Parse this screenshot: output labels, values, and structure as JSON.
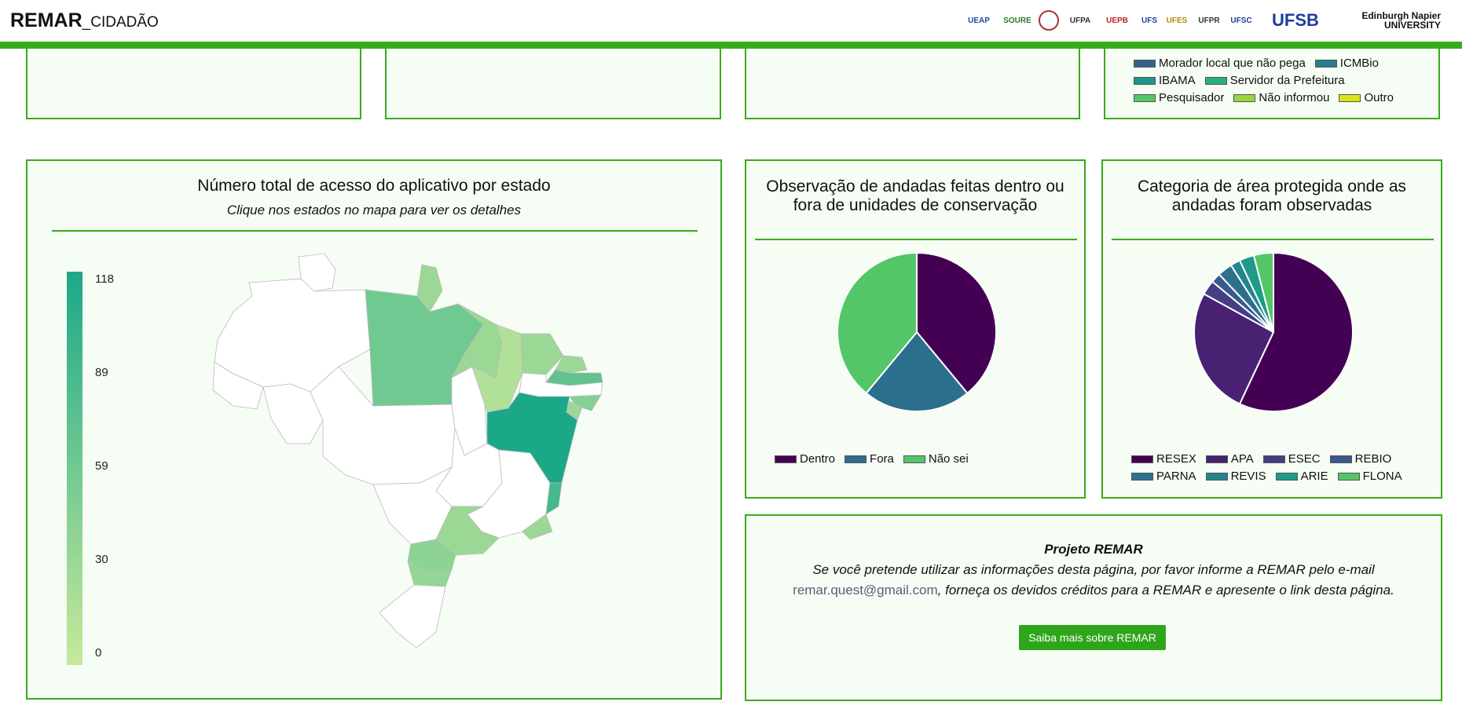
{
  "header": {
    "brand": "REMAR",
    "brand_sub": "_CIDADÃO",
    "logos": [
      {
        "name": "ueap-logo",
        "text": "UEAP",
        "color": "#1c4aa0"
      },
      {
        "name": "soure-logo",
        "text": "SOURE",
        "color": "#2c7a2c"
      },
      {
        "name": "seal-logo",
        "text": "",
        "color": "#a33"
      },
      {
        "name": "ufpa-logo",
        "text": "UFPA",
        "color": "#333"
      },
      {
        "name": "uepb-logo",
        "text": "UEPB",
        "color": "#b22"
      },
      {
        "name": "ufs-logo",
        "text": "UFS",
        "color": "#1c3f9a"
      },
      {
        "name": "ufes-logo",
        "text": "UFES",
        "color": "#b8860b"
      },
      {
        "name": "ufpr-logo",
        "text": "UFPR",
        "color": "#333"
      },
      {
        "name": "ufsc-logo",
        "text": "UFSC",
        "color": "#1c3f9a"
      },
      {
        "name": "ufsb-logo",
        "text": "UFSB",
        "color": "#1c3f9a"
      },
      {
        "name": "edinburgh-logo",
        "text": "Edinburgh Napier UNIVERSITY",
        "color": "#111"
      }
    ]
  },
  "top_legend": {
    "items": [
      {
        "label": "Morador local que não pega",
        "color": "#33638d"
      },
      {
        "label": "ICMBio",
        "color": "#287d8e"
      },
      {
        "label": "IBAMA",
        "color": "#1f968b"
      },
      {
        "label": "Servidor da Prefeitura",
        "color": "#29af7f"
      },
      {
        "label": "Pesquisador",
        "color": "#55c667"
      },
      {
        "label": "Não informou",
        "color": "#95d840"
      },
      {
        "label": "Outro",
        "color": "#dce319"
      }
    ]
  },
  "map_panel": {
    "title": "Número total de acesso do aplicativo por estado",
    "subtitle": "Clique nos estados no mapa para ver os detalhes",
    "scale_ticks": [
      "118",
      "89",
      "59",
      "30",
      "0"
    ],
    "scale_colors": {
      "low": "#c7e99a",
      "high": "#1ba889"
    },
    "states": [
      {
        "id": "RR",
        "value": 0
      },
      {
        "id": "AM",
        "value": 0
      },
      {
        "id": "AC",
        "value": 0
      },
      {
        "id": "RO",
        "value": 0
      },
      {
        "id": "AP",
        "value": 30
      },
      {
        "id": "PA",
        "value": 59
      },
      {
        "id": "MT",
        "value": 0
      },
      {
        "id": "TO",
        "value": 0
      },
      {
        "id": "MA",
        "value": 30
      },
      {
        "id": "PI",
        "value": 15
      },
      {
        "id": "CE",
        "value": 30
      },
      {
        "id": "RN",
        "value": 30
      },
      {
        "id": "PB",
        "value": 70
      },
      {
        "id": "PE",
        "value": 0
      },
      {
        "id": "AL",
        "value": 45
      },
      {
        "id": "SE",
        "value": 30
      },
      {
        "id": "BA",
        "value": 118
      },
      {
        "id": "GO",
        "value": 0
      },
      {
        "id": "DF",
        "value": 0
      },
      {
        "id": "MS",
        "value": 0
      },
      {
        "id": "MG",
        "value": 0
      },
      {
        "id": "ES",
        "value": 89
      },
      {
        "id": "RJ",
        "value": 30
      },
      {
        "id": "SP",
        "value": 30
      },
      {
        "id": "PR",
        "value": 40
      },
      {
        "id": "SC",
        "value": 35
      },
      {
        "id": "RS",
        "value": 0
      }
    ]
  },
  "pie1": {
    "title_line1": "Observação de andadas feitas dentro ou",
    "title_line2": "fora de unidades de conservação",
    "chart_data": {
      "type": "pie",
      "labels": [
        "Dentro",
        "Fora",
        "Não sei"
      ],
      "values": [
        39,
        22,
        39
      ],
      "colors": [
        "#440154",
        "#2c6e8e",
        "#55c667"
      ]
    }
  },
  "pie2": {
    "title_line1": "Categoria de área protegida onde as",
    "title_line2": "andadas foram observadas",
    "chart_data": {
      "type": "pie",
      "labels": [
        "RESEX",
        "APA",
        "ESEC",
        "REBIO",
        "PARNA",
        "REVIS",
        "ARIE",
        "FLONA"
      ],
      "values": [
        57,
        26,
        3,
        2,
        3,
        2,
        3,
        4
      ],
      "colors": [
        "#440154",
        "#482173",
        "#433e85",
        "#38598c",
        "#2d708e",
        "#25858e",
        "#1e9b8a",
        "#55c667"
      ]
    }
  },
  "info_panel": {
    "heading": "Projeto REMAR",
    "line1": "Se você pretende utilizar as informações desta página, por favor informe a REMAR pelo e-mail",
    "email": "remar.quest@gmail.com",
    "line2_rest": ", forneça os devidos créditos para a REMAR e apresente o link desta página.",
    "button": "Saiba mais sobre REMAR"
  }
}
